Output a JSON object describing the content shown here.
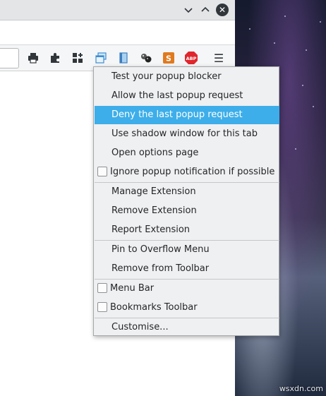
{
  "titlebar": {
    "minimize_glyph": "⌄",
    "maximize_glyph": "⌃",
    "close_glyph": "✕"
  },
  "toolbar": {
    "icons": [
      "print-icon",
      "extensions-icon",
      "add-widget-icon",
      "popup-blocker-icon",
      "reader-icon",
      "bubbles-icon",
      "sync-icon",
      "adblock-plus-icon",
      "hamburger-menu-icon"
    ],
    "abp_text": "ABP",
    "hamburger_glyph": "☰"
  },
  "menu": {
    "items": [
      {
        "label": "Test your popup blocker"
      },
      {
        "label": "Allow the last popup request"
      },
      {
        "label": "Deny the last popup request",
        "highlighted": true
      },
      {
        "label": "Use shadow window for this tab"
      },
      {
        "label": "Open options page"
      },
      {
        "label": "Ignore popup notification if possible",
        "checkbox": true,
        "checked": false
      },
      {
        "label": "Manage Extension"
      },
      {
        "label": "Remove Extension"
      },
      {
        "label": "Report Extension"
      },
      {
        "label": "Pin to Overflow Menu"
      },
      {
        "label": "Remove from Toolbar"
      },
      {
        "label": "Menu Bar",
        "checkbox": true,
        "checked": false
      },
      {
        "label": "Bookmarks Toolbar",
        "checkbox": true,
        "checked": false
      },
      {
        "label": "Customise..."
      }
    ]
  },
  "colors": {
    "highlight": "#3daee9",
    "menu_bg": "#eff0f1",
    "abp_red": "#e0262c"
  },
  "watermark": "wsxdn.com"
}
